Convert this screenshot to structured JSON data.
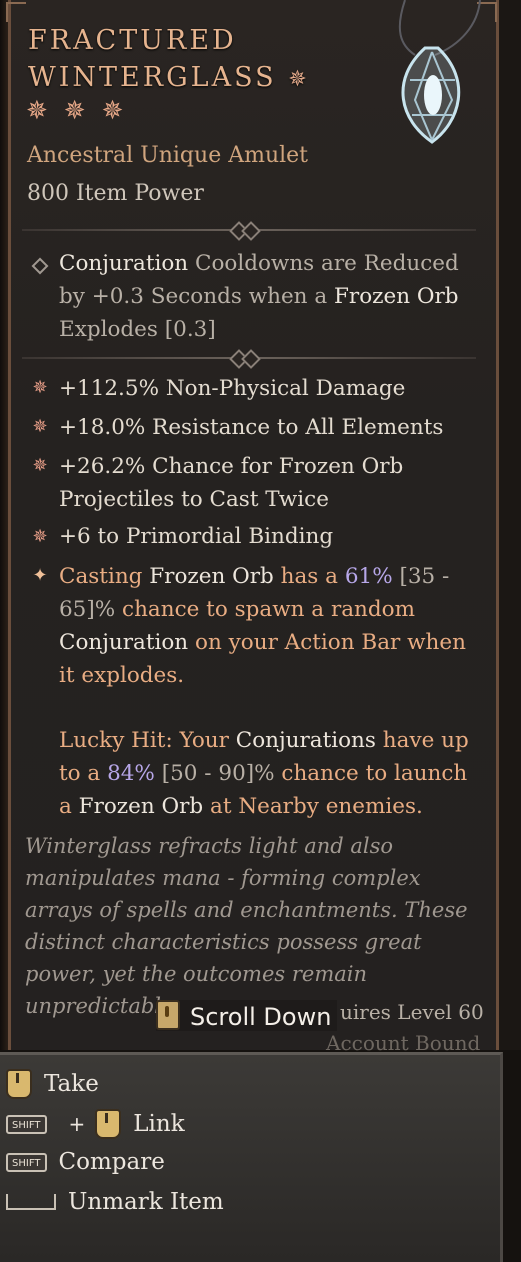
{
  "item": {
    "name_line1": "FRACTURED",
    "name_line2": "WINTERGLASS",
    "type": "Ancestral Unique Amulet",
    "power": "800 Item Power"
  },
  "implicit": {
    "p1": "Conjuration",
    "p2": " Cooldowns are Reduced by +0.3 Seconds when a ",
    "p3": "Frozen Orb",
    "p4": " Explodes [0.3]"
  },
  "affixes": [
    {
      "text": "+112.5% Non-Physical Damage"
    },
    {
      "text": "+18.0% Resistance to All Elements"
    },
    {
      "text": "+26.2% Chance for Frozen Orb Projectiles to Cast Twice"
    },
    {
      "text": "+6 to Primordial Binding"
    }
  ],
  "unique_power": {
    "s1": "Casting ",
    "s2": "Frozen Orb",
    "s3": " has a ",
    "s4": "61%",
    "s5": " [35 - 65]%",
    "s6": " chance to spawn a random ",
    "s7": "Conjuration",
    "s8": " on your Action Bar when it explodes.",
    "l1": "Lucky Hit: Your ",
    "l2": "Conjurations",
    "l3": " have up to a ",
    "l4": "84%",
    "l5": " [50 - 90]%",
    "l6": " chance to launch a ",
    "l7": "Frozen Orb",
    "l8": " at Nearby enemies."
  },
  "flavor": "Winterglass refracts light and also manipulates mana - forming complex arrays of spells and enchantments. These distinct characteristics possess great power, yet the outcomes remain unpredictable.",
  "requirements": {
    "level": "uires Level 60",
    "bound": "Account Bound"
  },
  "scroll_label": "Scroll Down",
  "controls": {
    "take": "Take",
    "link": "Link",
    "compare": "Compare",
    "unmark": "Unmark Item",
    "shift_key": "SHIFT",
    "plus": "+"
  },
  "colors": {
    "title": "#e6b48f",
    "orange_text": "#e9ad83",
    "value_purple": "#b7a7e8",
    "border": "#6a4e3c"
  }
}
